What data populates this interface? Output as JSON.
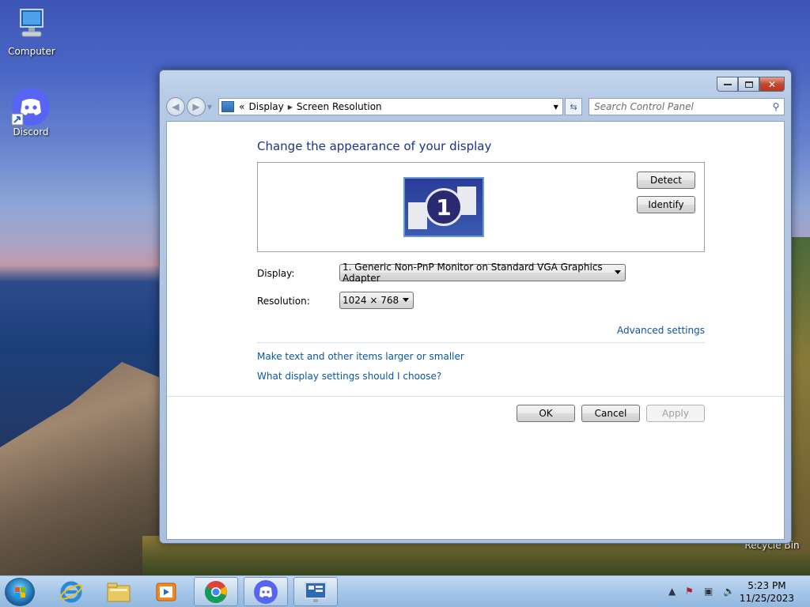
{
  "desktop": {
    "icons": [
      {
        "label": "Computer"
      },
      {
        "label": "Discord"
      },
      {
        "label": "Recycle Bin"
      }
    ]
  },
  "window": {
    "breadcrumb": [
      "Display",
      "Screen Resolution"
    ],
    "breadcrumb_prefix": "«",
    "search_placeholder": "Search Control Panel",
    "heading": "Change the appearance of your display",
    "monitor_number": "1",
    "detect_label": "Detect",
    "identify_label": "Identify",
    "display_label": "Display:",
    "display_value": "1. Generic Non-PnP Monitor on Standard VGA Graphics Adapter",
    "resolution_label": "Resolution:",
    "resolution_value": "1024 × 768",
    "advanced_link": "Advanced settings",
    "link_text_size": "Make text and other items larger or smaller",
    "link_help": "What display settings should I choose?",
    "ok_label": "OK",
    "cancel_label": "Cancel",
    "apply_label": "Apply"
  },
  "taskbar": {
    "items": [
      "start-orb",
      "internet-explorer",
      "file-explorer",
      "media-player",
      "chrome",
      "discord",
      "control-panel"
    ],
    "time": "5:23 PM",
    "date": "11/25/2023"
  },
  "colors": {
    "heading": "#1e3287",
    "link": "#0a56a6",
    "window_frame": "#b4c9e4"
  }
}
